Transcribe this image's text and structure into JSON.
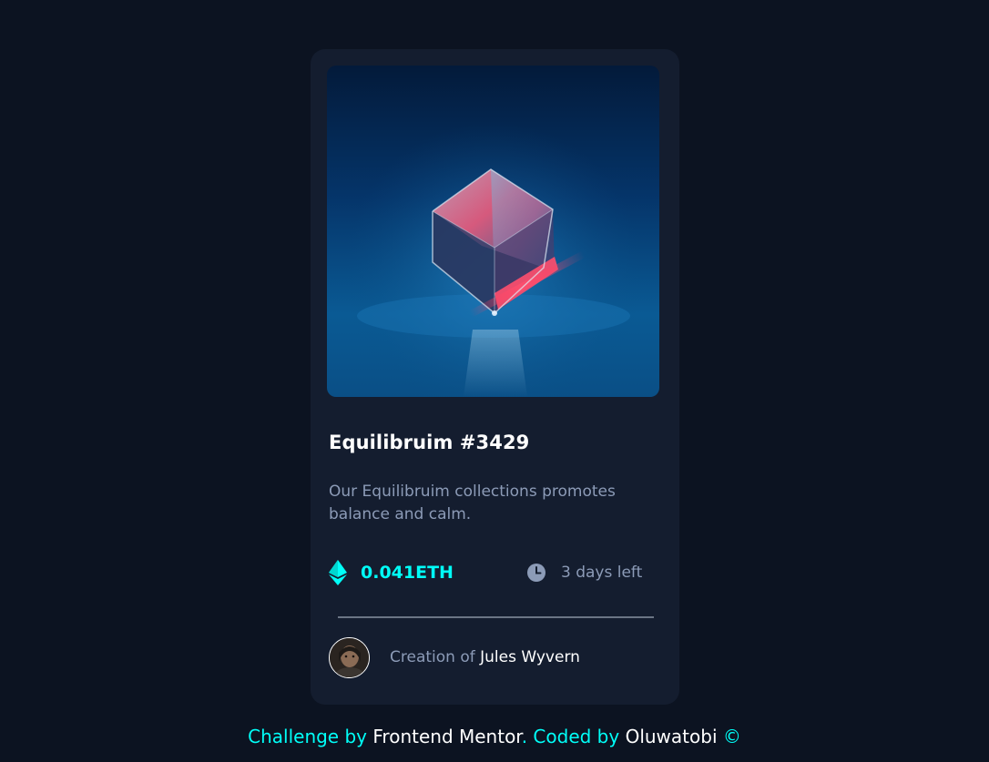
{
  "card": {
    "image_alt": "equilibrium-cube-image",
    "title": "Equilibruim #3429",
    "description": "Our Equilibruim collections promotes balance and calm.",
    "price": "0.041ETH",
    "time_left": "3 days left",
    "creator_prefix": "Creation of",
    "creator_name": "Jules Wyvern"
  },
  "footer": {
    "challenge_by": "Challenge by",
    "frontend_mentor": "Frontend Mentor",
    "dot": ".",
    "coded_by": "Coded by",
    "author": "Oluwatobi",
    "copyright": "©"
  },
  "icons": {
    "price": "ethereum-icon",
    "time": "clock-icon"
  },
  "colors": {
    "page_background": "#0c1321",
    "card_background": "#141d2f",
    "accent_cyan": "#00fff8",
    "soft_blue": "#8c9bb7",
    "white": "#ffffff",
    "divider": "#6b7585"
  }
}
